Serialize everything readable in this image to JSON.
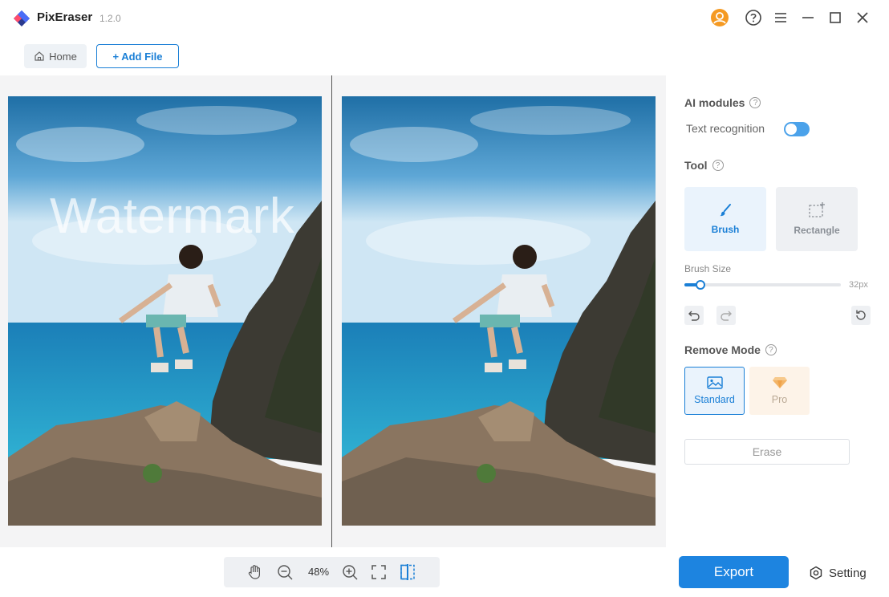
{
  "app": {
    "name": "PixEraser",
    "version": "1.2.0"
  },
  "titlebar": {
    "icons": [
      "account-icon",
      "help-icon",
      "menu-icon",
      "minimize-icon",
      "maximize-icon",
      "close-icon"
    ],
    "account_color": "#f59a23"
  },
  "nav": {
    "home_label": "Home",
    "add_file_label": "+ Add File"
  },
  "canvas": {
    "watermark_text": "Watermark",
    "zoom": "48%"
  },
  "panel": {
    "ai_modules_label": "AI modules",
    "text_recognition_label": "Text recognition",
    "text_recognition_on": true,
    "tool_label": "Tool",
    "tools": [
      {
        "label": "Brush",
        "icon": "brush-icon",
        "selected": true
      },
      {
        "label": "Rectangle",
        "icon": "rectangle-select-icon",
        "selected": false
      }
    ],
    "brush_size_label": "Brush Size",
    "brush_size_value": "32px",
    "brush_size_fraction": 0.1,
    "remove_mode_label": "Remove Mode",
    "modes": [
      {
        "label": "Standard",
        "icon": "image-icon",
        "selected": true
      },
      {
        "label": "Pro",
        "icon": "diamond-icon",
        "selected": false
      }
    ],
    "erase_label": "Erase"
  },
  "footer": {
    "export_label": "Export",
    "setting_label": "Setting"
  },
  "colors": {
    "accent": "#1a7fd6",
    "export": "#1d84e0",
    "pro": "#f0a64a"
  }
}
